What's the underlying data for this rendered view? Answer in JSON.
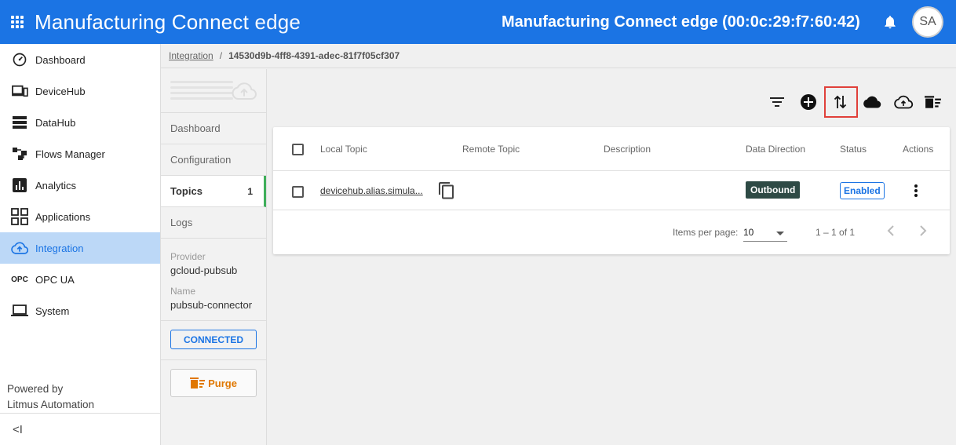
{
  "header": {
    "brand_main": "Manufacturing Connect",
    "brand_thin": " edge",
    "device_title": "Manufacturing Connect edge (00:0c:29:f7:60:42)",
    "avatar_initials": "SA",
    "color": "#1b74e4"
  },
  "sidebar": {
    "items": [
      {
        "label": "Dashboard",
        "icon": "speedometer-icon"
      },
      {
        "label": "DeviceHub",
        "icon": "devices-icon"
      },
      {
        "label": "DataHub",
        "icon": "storage-icon"
      },
      {
        "label": "Flows Manager",
        "icon": "flows-icon"
      },
      {
        "label": "Analytics",
        "icon": "analytics-icon"
      },
      {
        "label": "Applications",
        "icon": "apps-grid-icon"
      },
      {
        "label": "Integration",
        "icon": "cloud-upload-icon",
        "active": true
      },
      {
        "label": "OPC UA",
        "icon": "opc-icon",
        "icon_text": "OPC"
      },
      {
        "label": "System",
        "icon": "laptop-icon"
      }
    ],
    "powered_line1": "Powered by",
    "powered_line2": "Litmus Automation",
    "collapse_label": "<I"
  },
  "breadcrumb": {
    "parent": "Integration",
    "separator": "/",
    "current": "14530d9b-4ff8-4391-adec-81f7f05cf307"
  },
  "subnav": {
    "items": [
      {
        "label": "Dashboard"
      },
      {
        "label": "Configuration"
      },
      {
        "label": "Topics",
        "count": "1",
        "active": true
      },
      {
        "label": "Logs"
      }
    ],
    "provider_label": "Provider",
    "provider_value": "gcloud-pubsub",
    "name_label": "Name",
    "name_value": "pubsub-connector",
    "status": "CONNECTED",
    "purge_label": "Purge"
  },
  "toolbar": {
    "icons": [
      "filter-icon",
      "add-circle-icon",
      "import-export-icon",
      "cloud-icon",
      "cloud-outline-icon",
      "delete-sweep-icon"
    ]
  },
  "table": {
    "headers": {
      "local_topic": "Local Topic",
      "remote_topic": "Remote Topic",
      "description": "Description",
      "data_direction": "Data Direction",
      "status": "Status",
      "actions": "Actions"
    },
    "rows": [
      {
        "local_topic": "devicehub.alias.simula...",
        "remote_topic": "",
        "description": "",
        "data_direction": "Outbound",
        "status": "Enabled"
      }
    ],
    "pager": {
      "items_per_page_label": "Items per page:",
      "items_per_page_value": "10",
      "range": "1 – 1 of 1"
    }
  }
}
